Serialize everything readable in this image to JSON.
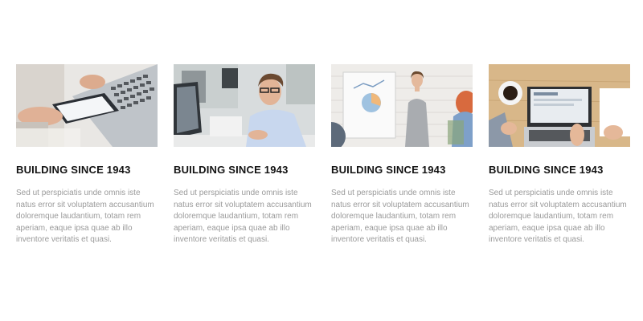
{
  "features": [
    {
      "image": "tablet-laptop-hands-photo",
      "title": "BUILDING SINCE 1943",
      "text": "Sed ut perspiciatis unde omnis iste natus error sit voluptatem accusantium doloremque laudantium, totam rem aperiam, eaque ipsa quae ab illo inventore veritatis et quasi."
    },
    {
      "image": "man-with-glasses-at-office-photo",
      "title": "BUILDING SINCE 1943",
      "text": "Sed ut perspiciatis unde omnis iste natus error sit voluptatem accusantium doloremque laudantium, totam rem aperiam, eaque ipsa quae ab illo inventore veritatis et quasi."
    },
    {
      "image": "woman-presenting-flipchart-photo",
      "title": "BUILDING SINCE 1943",
      "text": "Sed ut perspiciatis unde omnis iste natus error sit voluptatem accusantium doloremque laudantium, totam rem aperiam, eaque ipsa quae ab illo inventore veritatis et quasi."
    },
    {
      "image": "desk-laptop-coffee-topdown-photo",
      "title": "BUILDING SINCE 1943",
      "text": "Sed ut perspiciatis unde omnis iste natus error sit voluptatem accusantium doloremque laudantium, totam rem aperiam, eaque ipsa quae ab illo inventore veritatis et quasi."
    }
  ],
  "colors": {
    "background": "#ffffff",
    "title": "#121212",
    "body_text": "#9a9a9a"
  }
}
